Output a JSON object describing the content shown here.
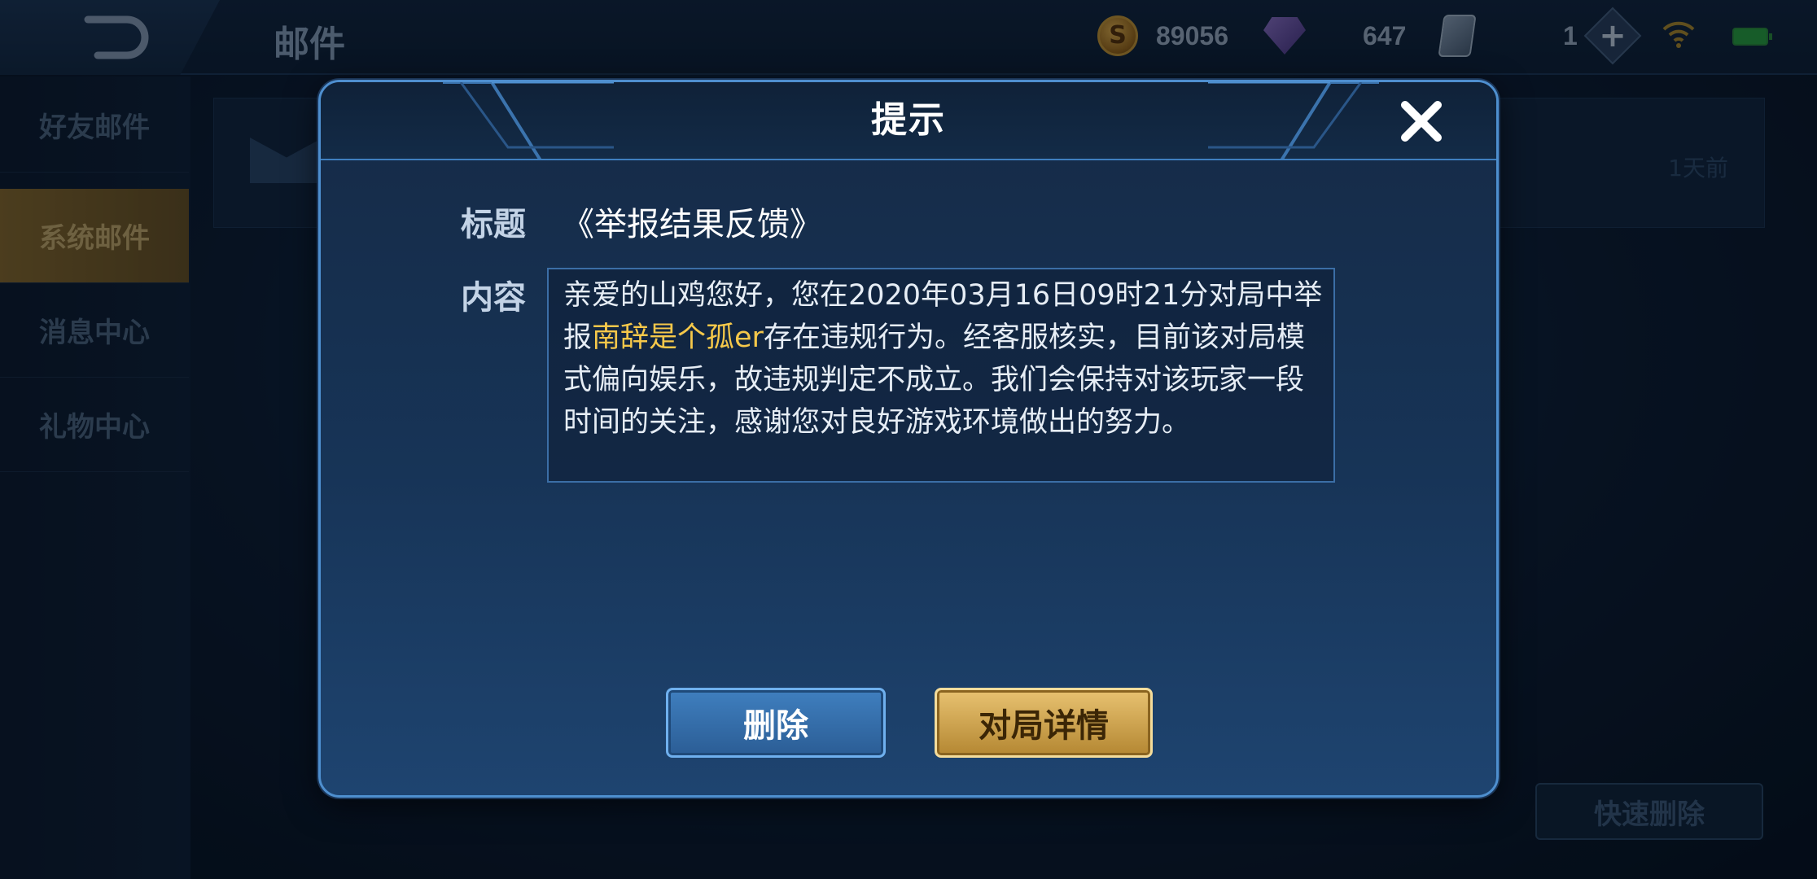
{
  "topbar": {
    "title": "邮件",
    "gold": "89056",
    "gems": "647",
    "cards": "1",
    "add_label": "+"
  },
  "sidebar": {
    "items": [
      {
        "label": "好友邮件",
        "active": false
      },
      {
        "label": "系统邮件",
        "active": true
      },
      {
        "label": "消息中心",
        "active": false
      },
      {
        "label": "礼物中心",
        "active": false
      }
    ]
  },
  "mail_list": {
    "rows": [
      {
        "time": "1天前"
      }
    ],
    "quick_delete_label": "快速删除"
  },
  "dialog": {
    "title": "提示",
    "subject_label": "标题",
    "subject": "《举报结果反馈》",
    "content_label": "内容",
    "content_before": "亲爱的山鸡您好，您在2020年03月16日09时21分对局中举报",
    "reported_player": "南辞是个孤er",
    "content_after": "存在违规行为。经客服核实，目前该对局模式偏向娱乐，故违规判定不成立。我们会保持对该玩家一段时间的关注，感谢您对良好游戏环境做出的努力。",
    "delete_label": "删除",
    "detail_label": "对局详情"
  },
  "colors": {
    "highlight": "#f5c84a",
    "delete_button": "#3f7fbf",
    "detail_button": "#d7ae5a",
    "active_tab": "#8a6a2a"
  }
}
